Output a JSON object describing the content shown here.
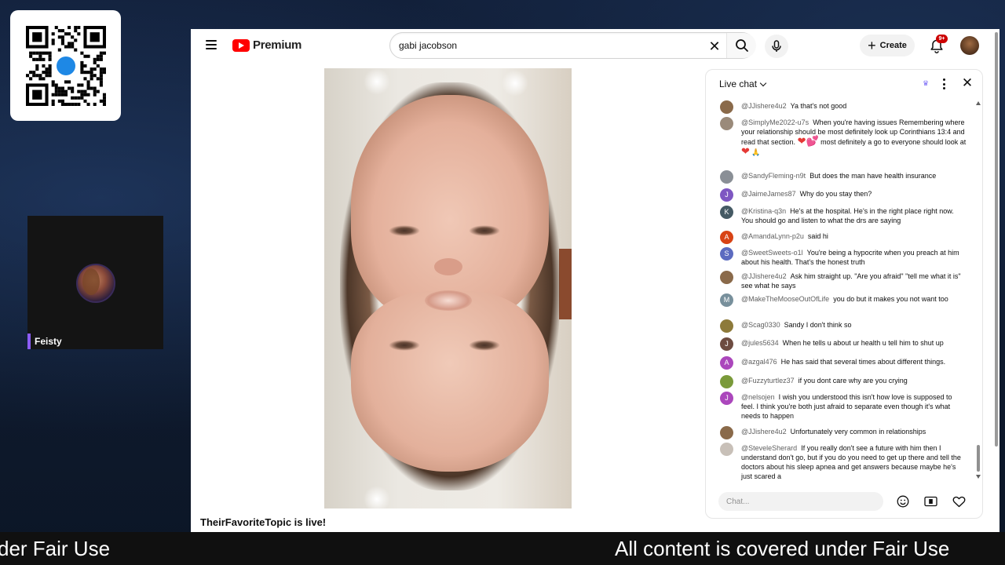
{
  "overlay": {
    "streamer_name": "Feisty",
    "ticker_left": "der Fair Use",
    "ticker_right": "All content is covered under Fair Use"
  },
  "youtube": {
    "logo_text": "Premium",
    "search": {
      "value": "gabi jacobson",
      "placeholder": "Search"
    },
    "create_label": "Create",
    "notification_badge": "9+",
    "status_text": "TheirFavoriteTopic is live!"
  },
  "chat": {
    "title": "Live chat",
    "input_placeholder": "Chat...",
    "messages": [
      {
        "author": "@JJishere4u2",
        "text": "Ya that's not good",
        "avatar_color": "#8a6a4a",
        "avatar_letter": ""
      },
      {
        "author": "@SimplyMe2022-u7s",
        "text": "When you're having issues Remembering where your relationship should be most definitely look up Corinthians 13:4 and read that section.",
        "text2": "most definitely a go to everyone should look at",
        "avatar_color": "#9a8a7a",
        "avatar_letter": ""
      },
      {
        "author": "@SandyFleming-n9t",
        "text": "But does the man have health insurance",
        "avatar_color": "#8a8f96",
        "avatar_letter": ""
      },
      {
        "author": "@JaimeJames87",
        "text": "Why do you stay then?",
        "avatar_color": "#7e57c2",
        "avatar_letter": "J"
      },
      {
        "author": "@Kristina-q3n",
        "text": "He's at the hospital. He's in the right place right now. You should go and listen to what the drs are saying",
        "avatar_color": "#455a64",
        "avatar_letter": "K"
      },
      {
        "author": "@AmandaLynn-p2u",
        "text": "said hi",
        "avatar_color": "#d84315",
        "avatar_letter": "A"
      },
      {
        "author": "@SweetSweets-o1l",
        "text": "You're being a hypocrite when you preach at him about his health. That's the honest truth",
        "avatar_color": "#5c6bc0",
        "avatar_letter": "S"
      },
      {
        "author": "@JJishere4u2",
        "text": "Ask him straight up. \"Are you afraid\" \"tell me what it is\" see what he says",
        "avatar_color": "#8a6a4a",
        "avatar_letter": ""
      },
      {
        "author": "@MakeTheMooseOutOfLife",
        "text": "you do but it makes you not want too",
        "avatar_color": "#78909c",
        "avatar_letter": "M"
      },
      {
        "author": "@Scag0330",
        "text": "Sandy I don't think so",
        "avatar_color": "#8d7a3a",
        "avatar_letter": ""
      },
      {
        "author": "@jules5634",
        "text": "When he tells u about ur health u tell him to shut up",
        "avatar_color": "#6d4c41",
        "avatar_letter": "J"
      },
      {
        "author": "@azgal476",
        "text": "He has said that several times about different things.",
        "avatar_color": "#ab47bc",
        "avatar_letter": "A"
      },
      {
        "author": "@Fuzzyturtlez37",
        "text": "if you dont care why are you crying",
        "avatar_color": "#7a9a3a",
        "avatar_letter": ""
      },
      {
        "author": "@nelsojen",
        "text": "I wish you understood this isn't how love is supposed to feel. I think you're both just afraid to separate even though it's what needs to happen",
        "avatar_color": "#ab47bc",
        "avatar_letter": "J"
      },
      {
        "author": "@JJishere4u2",
        "text": "Unfortunately very common in relationships",
        "avatar_color": "#8a6a4a",
        "avatar_letter": ""
      },
      {
        "author": "@SteveleSherard",
        "text": "If you really don't see a future with him then I understand don't go, but if you do you need to get up there and tell the doctors about his sleep apnea and get answers because maybe he's just scared a",
        "avatar_color": "#c8c0b8",
        "avatar_letter": ""
      }
    ]
  }
}
